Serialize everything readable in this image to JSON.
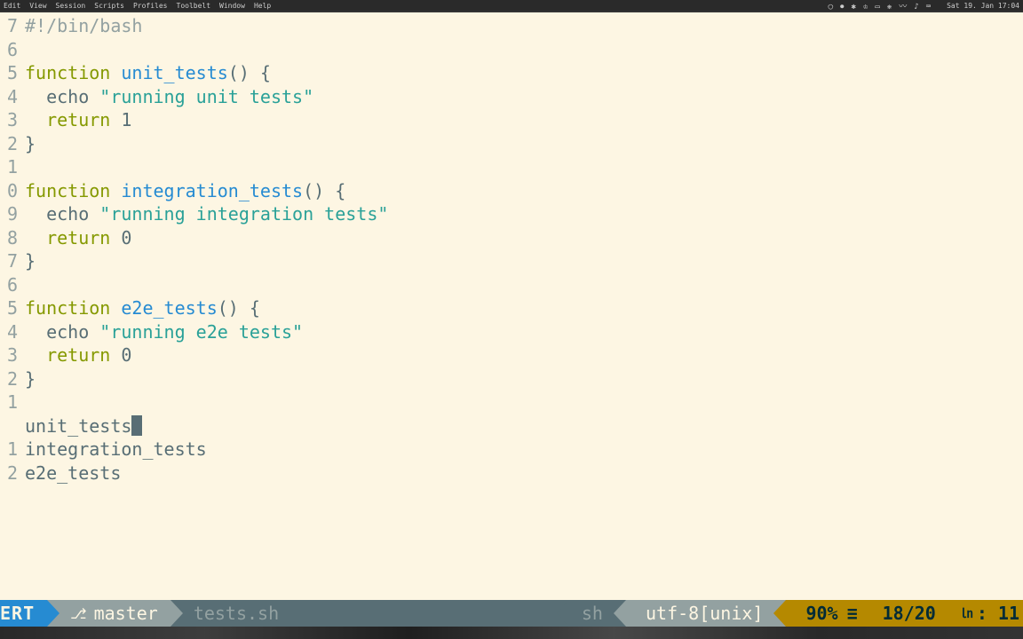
{
  "menubar": {
    "left": [
      "Edit",
      "View",
      "Session",
      "Scripts",
      "Profiles",
      "Toolbelt",
      "Window",
      "Help"
    ],
    "right_time": "Sat 19. Jan 17:04",
    "right_icons": [
      "◯",
      "⏺",
      "✱",
      "♔",
      "▭",
      "❋",
      "〰",
      "♪",
      "⌨"
    ]
  },
  "gutter_numbers": [
    "7",
    "6",
    "5",
    "4",
    "3",
    "2",
    "1",
    "0",
    "9",
    "8",
    "7",
    "6",
    "5",
    "4",
    "3",
    "2",
    "1",
    " ",
    "1",
    "2"
  ],
  "code_lines": [
    {
      "p": [
        [
          "cm",
          "#!/bin/bash"
        ]
      ]
    },
    {
      "p": []
    },
    {
      "p": [
        [
          "kw",
          "function "
        ],
        [
          "nm",
          "unit_tests"
        ],
        [
          "op",
          "() {"
        ]
      ]
    },
    {
      "p": [
        [
          "op",
          "  echo "
        ],
        [
          "str",
          "\"running unit tests\""
        ]
      ]
    },
    {
      "p": [
        [
          "kw",
          "  return "
        ],
        [
          "op",
          "1"
        ]
      ]
    },
    {
      "p": [
        [
          "op",
          "}"
        ]
      ]
    },
    {
      "p": []
    },
    {
      "p": [
        [
          "kw",
          "function "
        ],
        [
          "nm",
          "integration_tests"
        ],
        [
          "op",
          "() {"
        ]
      ]
    },
    {
      "p": [
        [
          "op",
          "  echo "
        ],
        [
          "str",
          "\"running integration tests\""
        ]
      ]
    },
    {
      "p": [
        [
          "kw",
          "  return "
        ],
        [
          "op",
          "0"
        ]
      ]
    },
    {
      "p": [
        [
          "op",
          "}"
        ]
      ]
    },
    {
      "p": []
    },
    {
      "p": [
        [
          "kw",
          "function "
        ],
        [
          "nm",
          "e2e_tests"
        ],
        [
          "op",
          "() {"
        ]
      ]
    },
    {
      "p": [
        [
          "op",
          "  echo "
        ],
        [
          "str",
          "\"running e2e tests\""
        ]
      ]
    },
    {
      "p": [
        [
          "kw",
          "  return "
        ],
        [
          "op",
          "0"
        ]
      ]
    },
    {
      "p": [
        [
          "op",
          "}"
        ]
      ]
    },
    {
      "p": []
    },
    {
      "p": [
        [
          "op",
          "unit_tests"
        ]
      ],
      "cursor": true
    },
    {
      "p": [
        [
          "op",
          "integration_tests"
        ]
      ]
    },
    {
      "p": [
        [
          "op",
          "e2e_tests"
        ]
      ]
    }
  ],
  "statusbar": {
    "mode": "ERT",
    "branch": "master",
    "filename": "tests.sh",
    "filetype": "sh",
    "encoding": "utf-8[unix]",
    "percent": "90%",
    "position": "18/20",
    "ln_glyph": "㏑",
    "col": ": 11"
  }
}
